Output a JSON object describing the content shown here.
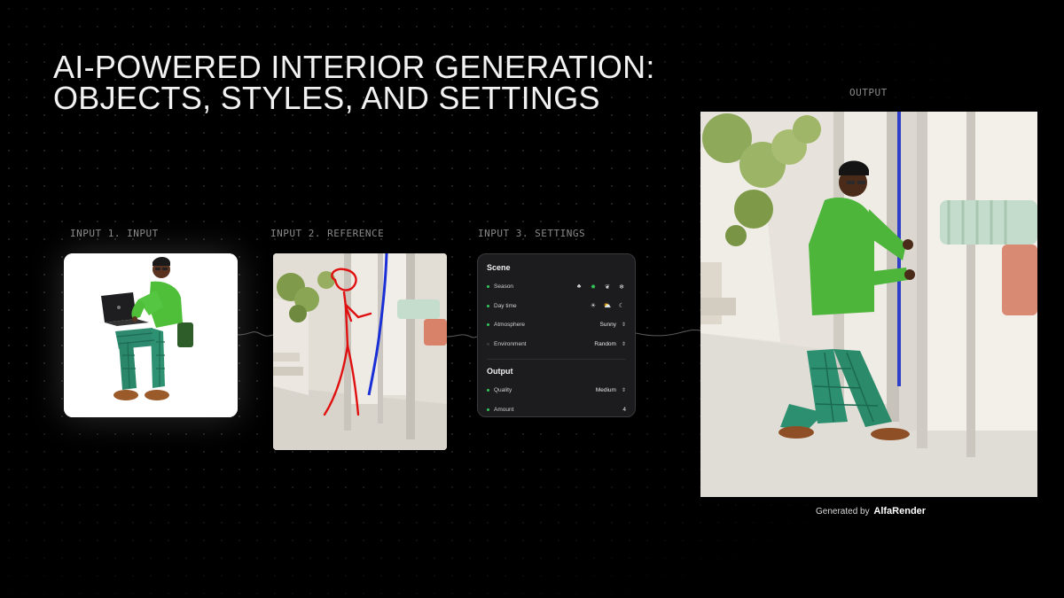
{
  "slide": {
    "title_line1": "AI-POWERED INTERIOR GENERATION:",
    "title_line2": "OBJECTS, STYLES, AND SETTINGS"
  },
  "labels": {
    "input1": "INPUT 1. INPUT",
    "input2": "INPUT 2. REFERENCE",
    "input3": "INPUT 3. SETTINGS",
    "output": "OUTPUT"
  },
  "settings": {
    "scene_title": "Scene",
    "season_label": "Season",
    "season_icons": [
      "sprout-icon",
      "sun-flower-icon",
      "leaf-icon",
      "snowflake-icon"
    ],
    "season_active": "sun-flower-icon",
    "daytime_label": "Day time",
    "daytime_icons": [
      "sun-icon",
      "sunset-icon",
      "moon-icon"
    ],
    "atmosphere_label": "Atmosphere",
    "atmosphere_value": "Sunny",
    "environment_label": "Environment",
    "environment_value": "Random",
    "output_title": "Output",
    "quality_label": "Quality",
    "quality_value": "Medium",
    "amount_label": "Amount",
    "amount_value": "4"
  },
  "footer": {
    "prefix": "Generated by",
    "brand": "AlfaRender"
  },
  "colors": {
    "background": "#000000",
    "accent_green": "#34c759",
    "sketch_red": "#e01010",
    "sketch_blue": "#1a2fd6"
  }
}
